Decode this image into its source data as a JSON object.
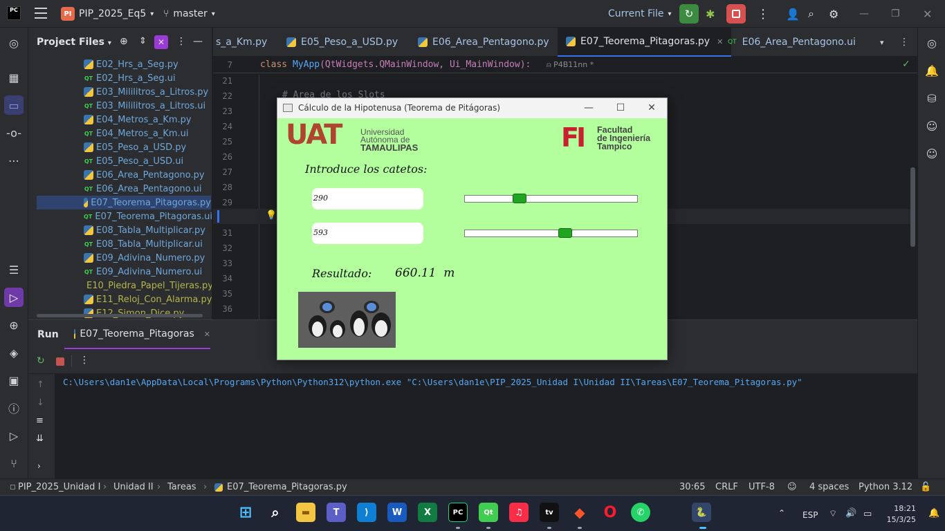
{
  "topbar": {
    "logo": "PC",
    "project_badge": "PI",
    "project_name": "PIP_2025_Eq5",
    "branch": "master",
    "run_config": "Current File"
  },
  "project_panel": {
    "title": "Project Files",
    "files": [
      {
        "name": "E02_Hrs_a_Seg.py",
        "type": "py",
        "color": "blue"
      },
      {
        "name": "E02_Hrs_a_Seg.ui",
        "type": "ui",
        "color": "blue"
      },
      {
        "name": "E03_Mililitros_a_Litros.py",
        "type": "py",
        "color": "blue"
      },
      {
        "name": "E03_Mililitros_a_Litros.ui",
        "type": "ui",
        "color": "blue"
      },
      {
        "name": "E04_Metros_a_Km.py",
        "type": "py",
        "color": "blue"
      },
      {
        "name": "E04_Metros_a_Km.ui",
        "type": "ui",
        "color": "blue"
      },
      {
        "name": "E05_Peso_a_USD.py",
        "type": "py",
        "color": "blue"
      },
      {
        "name": "E05_Peso_a_USD.ui",
        "type": "ui",
        "color": "blue"
      },
      {
        "name": "E06_Area_Pentagono.py",
        "type": "py",
        "color": "blue"
      },
      {
        "name": "E06_Area_Pentagono.ui",
        "type": "ui",
        "color": "blue"
      },
      {
        "name": "E07_Teorema_Pitagoras.py",
        "type": "py",
        "color": "blue",
        "selected": true
      },
      {
        "name": "E07_Teorema_Pitagoras.ui",
        "type": "ui",
        "color": "blue"
      },
      {
        "name": "E08_Tabla_Multiplicar.py",
        "type": "py",
        "color": "blue"
      },
      {
        "name": "E08_Tabla_Multiplicar.ui",
        "type": "ui",
        "color": "blue"
      },
      {
        "name": "E09_Adivina_Numero.py",
        "type": "py",
        "color": "blue"
      },
      {
        "name": "E09_Adivina_Numero.ui",
        "type": "ui",
        "color": "blue"
      },
      {
        "name": "E10_Piedra_Papel_Tijeras.py",
        "type": "py",
        "color": "olive"
      },
      {
        "name": "E11_Reloj_Con_Alarma.py",
        "type": "py",
        "color": "olive"
      },
      {
        "name": "E12_Simon_Dice.py",
        "type": "py",
        "color": "olive"
      }
    ]
  },
  "tabs": [
    {
      "label": "s_a_Km.py",
      "icon": false
    },
    {
      "label": "E05_Peso_a_USD.py",
      "icon": true
    },
    {
      "label": "E06_Area_Pentagono.py",
      "icon": true
    },
    {
      "label": "E07_Teorema_Pitagoras.py",
      "icon": true,
      "active": true
    },
    {
      "label": "E06_Area_Pentagono.ui",
      "icon": false
    }
  ],
  "editor": {
    "sticky_line": "7",
    "sticky_kw": "class",
    "sticky_name": "MyApp",
    "sticky_args": "(QtWidgets.QMainWindow, Ui_MainWindow):",
    "sticky_author": "P4B11nn *",
    "line_numbers": [
      "21",
      "22",
      "23",
      "24",
      "25",
      "26",
      "27",
      "28",
      "29",
      "30",
      "31",
      "32",
      "33",
      "34",
      "35",
      "36"
    ],
    "comment": "# Area de los Slots"
  },
  "run_panel": {
    "title": "Run",
    "tab": "E07_Teorema_Pitagoras",
    "console": "C:\\Users\\dan1e\\AppData\\Local\\Programs\\Python\\Python312\\python.exe \"C:\\Users\\dan1e\\PIP_2025_Unidad I\\Unidad II\\Tareas\\E07_Teorema_Pitagoras.py\""
  },
  "popup": {
    "title": "Cálculo de la Hipotenusa (Teorema de Pitágoras)",
    "uat_big": "UAT",
    "uat_line1": "Universidad",
    "uat_line2": "Autónoma de",
    "uat_line3": "TAMAULIPAS",
    "fi_mark": "FI",
    "fi_line1": "Facultad",
    "fi_line2": "de Ingeniería",
    "fi_line3": "Tampico",
    "prompt": "Introduce los catetos:",
    "cateto1": "290",
    "cateto2": "593",
    "slider1_fraction": 0.3,
    "slider2_fraction": 0.59,
    "result_label": "Resultado:",
    "result_value": "660.11",
    "result_unit": "m"
  },
  "statusbar": {
    "crumbs": [
      "PIP_2025_Unidad I",
      "Unidad II",
      "Tareas",
      "E07_Teorema_Pitagoras.py"
    ],
    "position": "30:65",
    "line_sep": "CRLF",
    "encoding": "UTF-8",
    "indent": "4 spaces",
    "interpreter": "Python 3.12"
  },
  "taskbar": {
    "lang": "ESP",
    "time": "18:21",
    "date": "15/3/25"
  },
  "colors": {
    "accent": "#3574f0",
    "popup_bg": "#b3ff9d",
    "slider_handle": "#1fa51f",
    "run_green": "#3d8b40",
    "stop_red": "#d6514f"
  }
}
